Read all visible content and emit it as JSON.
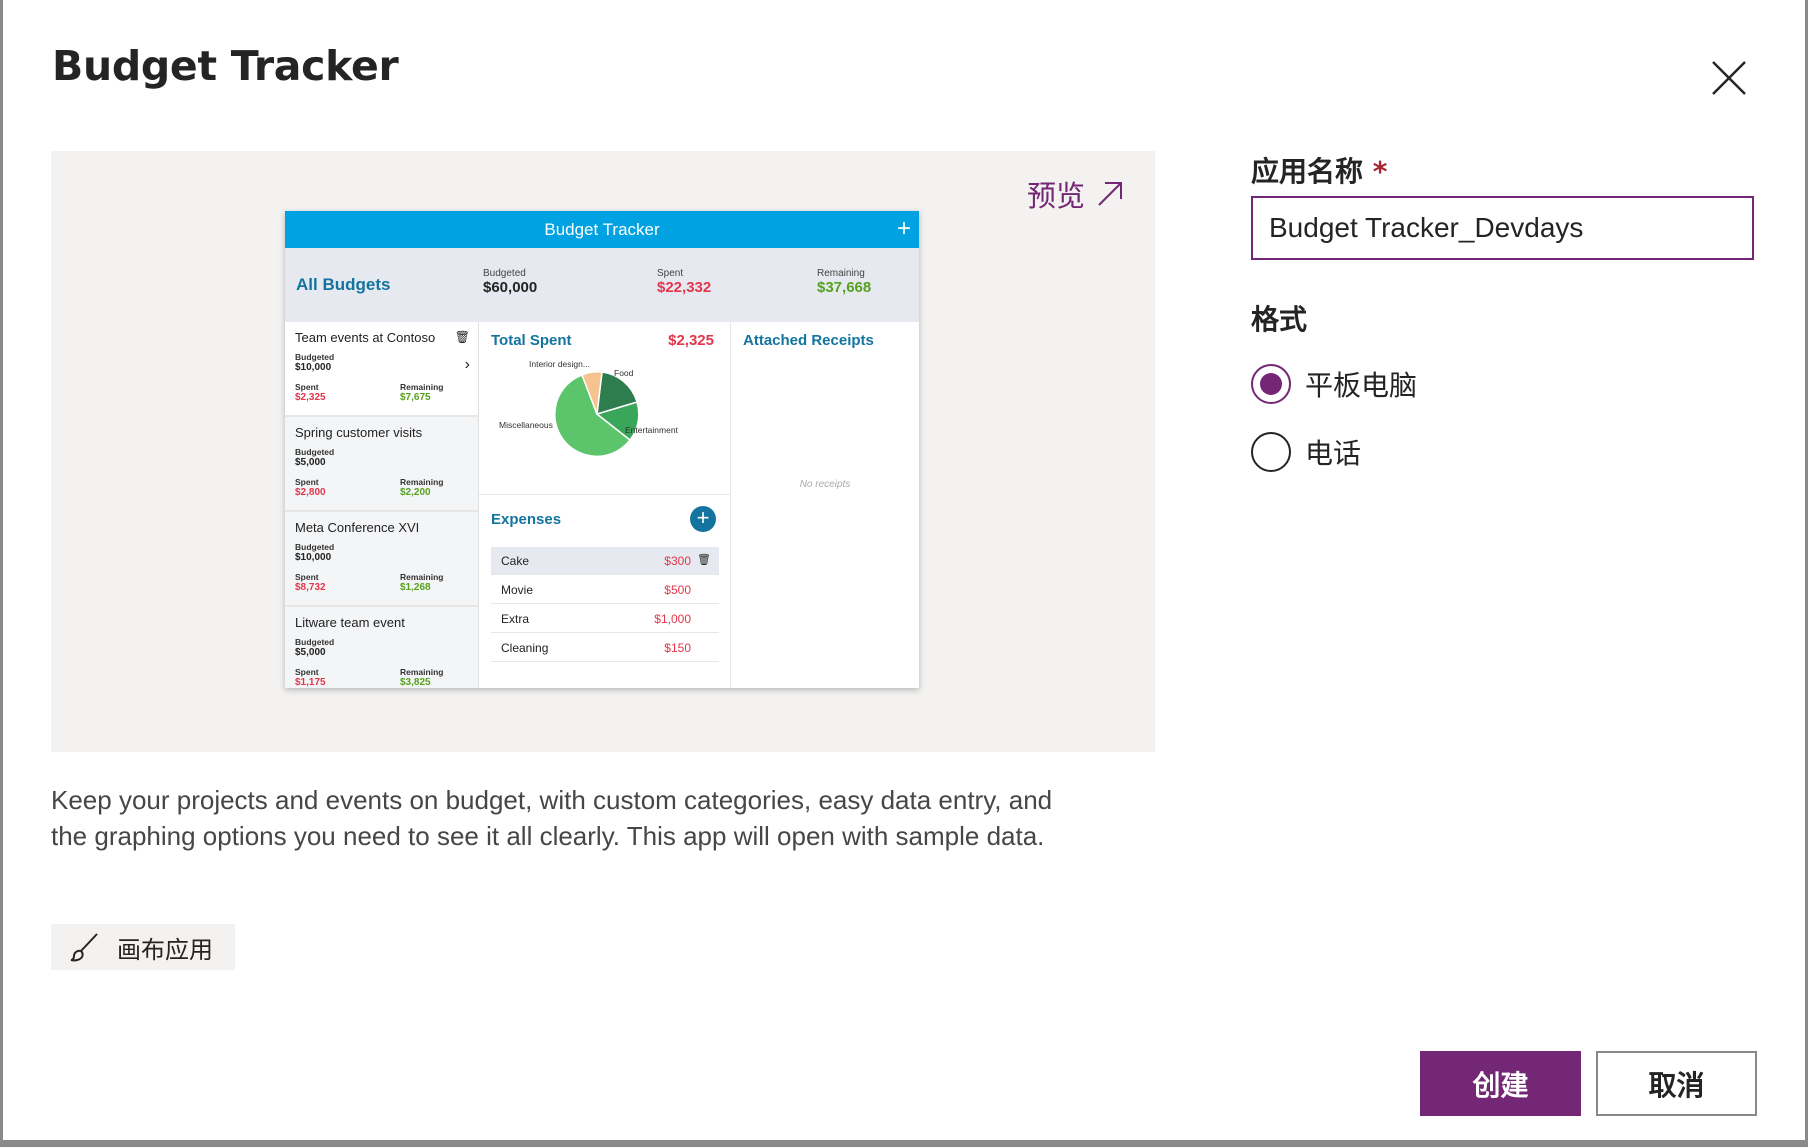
{
  "dialog": {
    "title": "Budget Tracker",
    "close_icon": "close-icon",
    "description": "Keep your projects and events on budget, with custom categories, easy data entry, and the graphing options you need to see it all clearly. This app will open with sample data.",
    "tag_label": "画布应用",
    "tag_icon": "paintbrush-icon"
  },
  "preview": {
    "link_label": "预览",
    "link_icon": "arrow-up-right-icon",
    "app": {
      "header_title": "Budget Tracker",
      "summary": {
        "title": "All Budgets",
        "budgeted_label": "Budgeted",
        "budgeted_value": "$60,000",
        "spent_label": "Spent",
        "spent_value": "$22,332",
        "remaining_label": "Remaining",
        "remaining_value": "$37,668"
      },
      "budgets": [
        {
          "name": "Team events at Contoso",
          "budgeted_label": "Budgeted",
          "budgeted": "$10,000",
          "spent_label": "Spent",
          "spent": "$2,325",
          "remaining_label": "Remaining",
          "remaining": "$7,675"
        },
        {
          "name": "Spring customer visits",
          "budgeted_label": "Budgeted",
          "budgeted": "$5,000",
          "spent_label": "Spent",
          "spent": "$2,800",
          "remaining_label": "Remaining",
          "remaining": "$2,200"
        },
        {
          "name": "Meta Conference XVI",
          "budgeted_label": "Budgeted",
          "budgeted": "$10,000",
          "spent_label": "Spent",
          "spent": "$8,732",
          "remaining_label": "Remaining",
          "remaining": "$1,268"
        },
        {
          "name": "Litware team event",
          "budgeted_label": "Budgeted",
          "budgeted": "$5,000",
          "spent_label": "Spent",
          "spent": "$1,175",
          "remaining_label": "Remaining",
          "remaining": "$3,825"
        }
      ],
      "total_spent_label": "Total Spent",
      "total_spent_value": "$2,325",
      "pie_labels": {
        "interior": "Interior design...",
        "food": "Food",
        "misc": "Miscellaneous",
        "entertainment": "Entertainment"
      },
      "pie_colors": {
        "interior": "#f5c38f",
        "food": "#2e7d4f",
        "entertainment": "#3aa65a",
        "misc": "#5cc46a"
      },
      "expenses_label": "Expenses",
      "expenses": [
        {
          "name": "Cake",
          "amount": "$300"
        },
        {
          "name": "Movie",
          "amount": "$500"
        },
        {
          "name": "Extra",
          "amount": "$1,000"
        },
        {
          "name": "Cleaning",
          "amount": "$150"
        }
      ],
      "attached_receipts_label": "Attached Receipts",
      "no_receipts_label": "No receipts"
    }
  },
  "form": {
    "app_name_label": "应用名称",
    "required_mark": "*",
    "app_name_value": "Budget Tracker_Devdays",
    "format_label": "格式",
    "format_options": [
      {
        "label": "平板电脑",
        "selected": true
      },
      {
        "label": "电话",
        "selected": false
      }
    ],
    "accent_color": "#742774"
  },
  "footer": {
    "create_label": "创建",
    "cancel_label": "取消"
  }
}
